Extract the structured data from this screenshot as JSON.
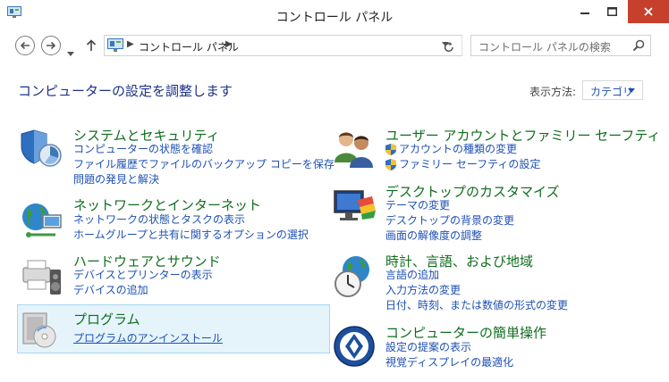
{
  "window": {
    "title": "コントロール パネル",
    "minimize_icon": "minimize-icon",
    "maximize_icon": "maximize-icon",
    "close_icon": "close-icon"
  },
  "nav": {
    "address_text": "コントロール パネル",
    "search_placeholder": "コントロール パネルの検索"
  },
  "header": {
    "title": "コンピューターの設定を調整します",
    "view_label": "表示方法:",
    "view_value": "カテゴリ"
  },
  "categories": {
    "system": {
      "title": "システムとセキュリティ",
      "links": [
        "コンピューターの状態を確認",
        "ファイル履歴でファイルのバックアップ コピーを保存",
        "問題の発見と解決"
      ]
    },
    "network": {
      "title": "ネットワークとインターネット",
      "links": [
        "ネットワークの状態とタスクの表示",
        "ホームグループと共有に関するオプションの選択"
      ]
    },
    "hardware": {
      "title": "ハードウェアとサウンド",
      "links": [
        "デバイスとプリンターの表示",
        "デバイスの追加"
      ]
    },
    "programs": {
      "title": "プログラム",
      "links": [
        "プログラムのアンインストール"
      ]
    },
    "users": {
      "title": "ユーザー アカウントとファミリー セーフティ",
      "links": [
        "アカウントの種類の変更",
        "ファミリー セーフティの設定"
      ]
    },
    "desktop": {
      "title": "デスクトップのカスタマイズ",
      "links": [
        "テーマの変更",
        "デスクトップの背景の変更",
        "画面の解像度の調整"
      ]
    },
    "clock": {
      "title": "時計、言語、および地域",
      "links": [
        "言語の追加",
        "入力方法の変更",
        "日付、時刻、または数値の形式の変更"
      ]
    },
    "access": {
      "title": "コンピューターの簡単操作",
      "links": [
        "設定の提案の表示",
        "視覚ディスプレイの最適化"
      ]
    }
  },
  "colors": {
    "category_title": "#0f6e1e",
    "link": "#1e50b4",
    "page_title": "#1e3287",
    "close_button": "#c7402c",
    "hover_bg": "#e5f3fb"
  }
}
